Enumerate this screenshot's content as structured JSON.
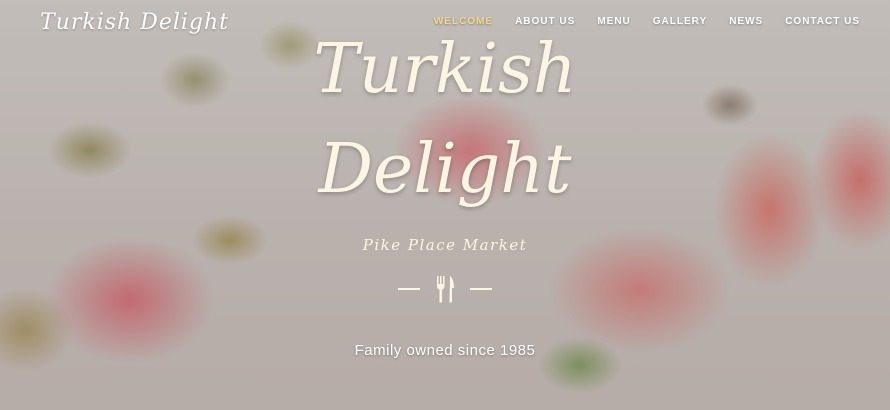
{
  "site": {
    "logo_text": "Turkish Delight"
  },
  "nav": {
    "items": [
      {
        "label": "WELCOME",
        "active": true
      },
      {
        "label": "ABOUT US",
        "active": false
      },
      {
        "label": "MENU",
        "active": false
      },
      {
        "label": "GALLERY",
        "active": false
      },
      {
        "label": "NEWS",
        "active": false
      },
      {
        "label": "CONTACT US",
        "active": false
      }
    ],
    "active_color": "#f0d98a"
  },
  "hero": {
    "title_line1": "Turkish",
    "title_line2": "Delight",
    "subtitle": "Pike Place Market",
    "divider_icon": "fork-knife-icon",
    "tagline": "Family owned since 1985"
  },
  "colors": {
    "text_cream": "#fbf5e3",
    "nav_text": "#ffffff"
  }
}
